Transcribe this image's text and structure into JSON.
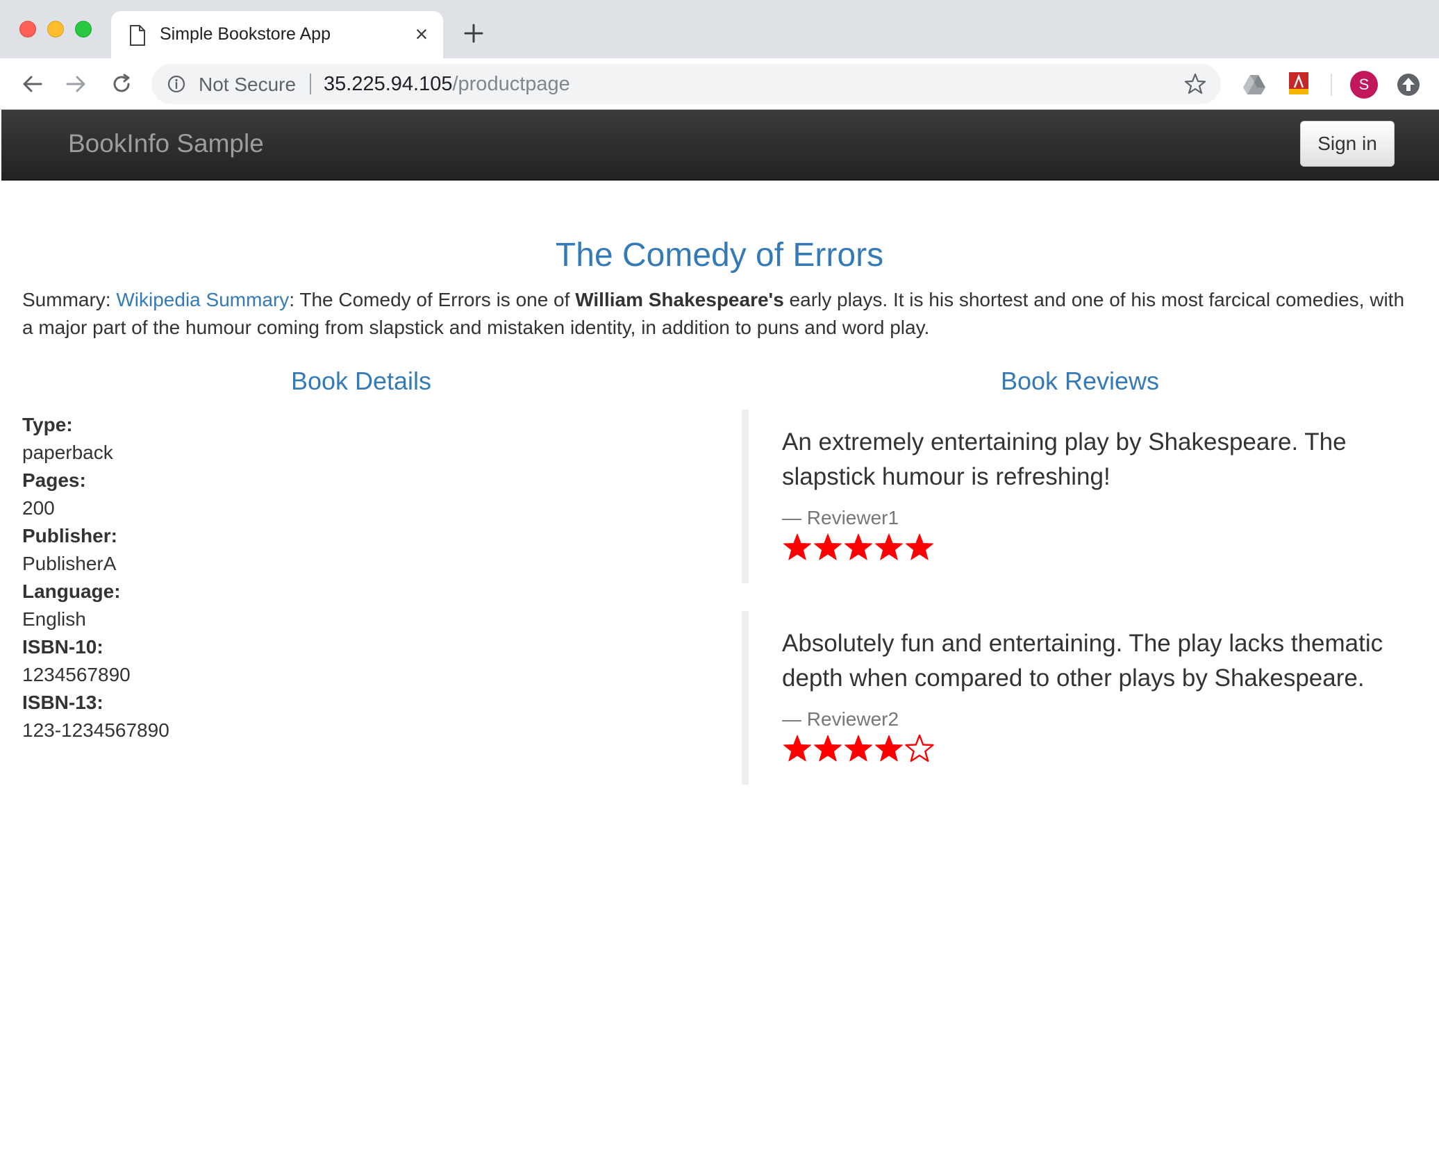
{
  "browser": {
    "tab_title": "Simple Bookstore App",
    "close_glyph": "×",
    "not_secure_label": "Not Secure",
    "url_host": "35.225.94.105",
    "url_path": "/productpage",
    "profile_initial": "S"
  },
  "navbar": {
    "brand": "BookInfo Sample",
    "signin_label": "Sign in"
  },
  "book": {
    "title": "The Comedy of Errors",
    "summary_prefix": "Summary: ",
    "summary_link": "Wikipedia Summary",
    "summary_text_1": ": The Comedy of Errors is one of ",
    "summary_bold": "William Shakespeare's",
    "summary_text_2": " early plays. It is his shortest and one of his most farcical comedies, with a major part of the humour coming from slapstick and mistaken identity, in addition to puns and word play."
  },
  "details": {
    "heading": "Book Details",
    "fields": [
      {
        "label": "Type:",
        "value": "paperback"
      },
      {
        "label": "Pages:",
        "value": "200"
      },
      {
        "label": "Publisher:",
        "value": "PublisherA"
      },
      {
        "label": "Language:",
        "value": "English"
      },
      {
        "label": "ISBN-10:",
        "value": "1234567890"
      },
      {
        "label": "ISBN-13:",
        "value": "123-1234567890"
      }
    ]
  },
  "reviews": {
    "heading": "Book Reviews",
    "star_color": "#ff0000",
    "items": [
      {
        "text": "An extremely entertaining play by Shakespeare. The slapstick humour is refreshing!",
        "author": "— Reviewer1",
        "rating": 5,
        "max_rating": 5
      },
      {
        "text": "Absolutely fun and entertaining. The play lacks thematic depth when compared to other plays by Shakespeare.",
        "author": "— Reviewer2",
        "rating": 4,
        "max_rating": 5
      }
    ]
  },
  "colors": {
    "link_blue": "#337ab7",
    "navbar_dark": "#222222",
    "text": "#333333",
    "muted": "#777777"
  },
  "icons": [
    "page-icon",
    "close-icon",
    "plus-icon",
    "back-icon",
    "forward-icon",
    "reload-icon",
    "info-icon",
    "star-bookmark-icon",
    "drive-icon",
    "pdf-extension-icon",
    "profile-avatar",
    "update-icon"
  ]
}
